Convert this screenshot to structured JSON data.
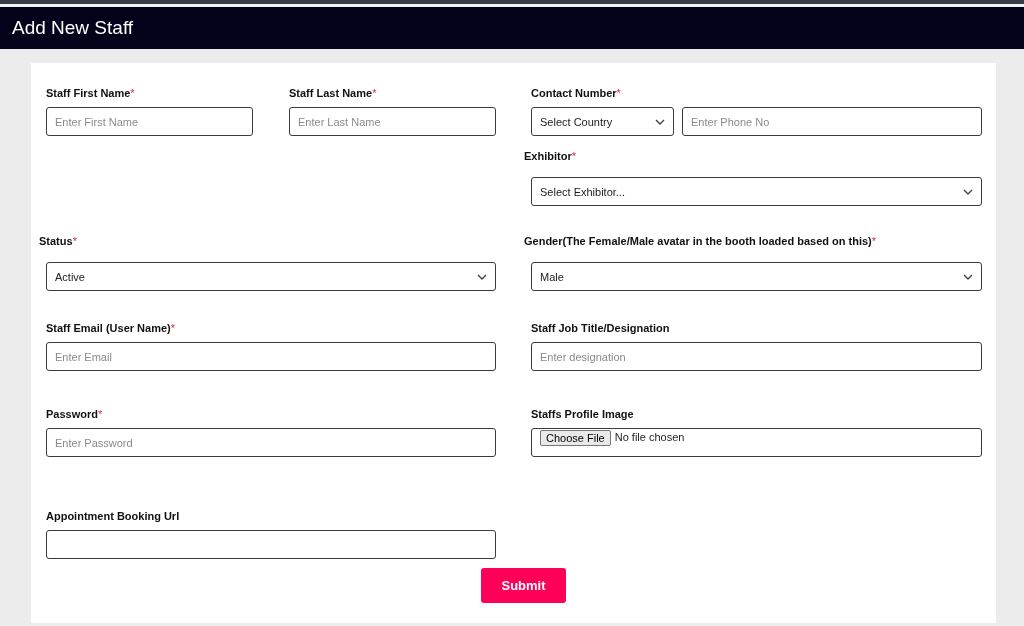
{
  "page_title": "Add New Staff",
  "rows": [
    {
      "left": [
        {
          "kind": "text",
          "label": "Staff First Name",
          "required_mark": "*",
          "placeholder": "Enter First Name"
        },
        {
          "kind": "text",
          "label": "Staff Last Name",
          "required_mark": "*",
          "placeholder": "Enter Last Name"
        }
      ],
      "right": [
        {
          "kind": "phone",
          "label": "Contact Number",
          "required_mark": "*",
          "country": "Select Country",
          "placeholder": "Enter Phone No"
        }
      ]
    },
    {
      "left": [],
      "right": [
        {
          "kind": "select",
          "label": "Exhibitor",
          "required_mark": "*",
          "value": "Select Exhibitor..."
        }
      ]
    },
    {
      "left": [
        {
          "kind": "select",
          "label": "Status",
          "required_mark": "*",
          "value": "Active"
        }
      ],
      "right": [
        {
          "kind": "select",
          "label": "Gender(The Female/Male avatar in the booth loaded based on this)",
          "required_mark": "*",
          "value": "Male"
        }
      ]
    },
    {
      "left": [
        {
          "kind": "text",
          "label": "Staff Email (User Name)",
          "required_mark": "*",
          "placeholder": "Enter Email"
        }
      ],
      "right": [
        {
          "kind": "text",
          "label": "Staff Job Title/Designation",
          "placeholder": "Enter designation"
        }
      ]
    },
    {
      "left": [
        {
          "kind": "text",
          "label": "Password",
          "required_mark": "*",
          "placeholder": "Enter Password"
        }
      ],
      "right": [
        {
          "kind": "file",
          "label": "Staffs Profile Image",
          "button": "Choose File",
          "status": "No file chosen"
        }
      ]
    },
    {
      "left": [
        {
          "kind": "text",
          "label": "Appointment Booking Url"
        }
      ],
      "right": []
    }
  ],
  "submit": "Submit"
}
